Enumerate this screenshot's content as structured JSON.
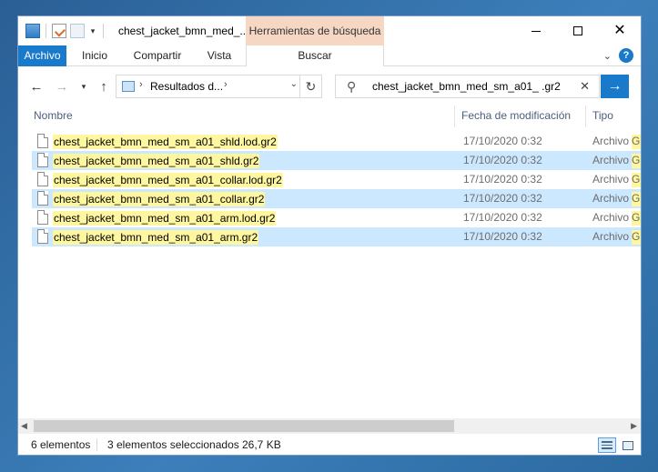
{
  "window": {
    "title": "chest_jacket_bmn_med_...",
    "contextual_header": "Herramientas de búsqueda"
  },
  "ribbon": {
    "tabs": [
      "Archivo",
      "Inicio",
      "Compartir",
      "Vista",
      "Buscar"
    ],
    "help": "?"
  },
  "navigation": {
    "back_icon": "←",
    "forward_icon": "→",
    "recent_icon": "▾",
    "up_icon": "↑",
    "address_text": "Resultados d...",
    "breadcrumb_separator": "›",
    "address_dropdown": "⌄",
    "refresh_icon": "↻",
    "search_value": "chest_jacket_bmn_med_sm_a01_ .gr2",
    "search_clear": "✕",
    "search_go": "→"
  },
  "columns": {
    "name": "Nombre",
    "date": "Fecha de modificación",
    "type": "Tipo"
  },
  "files": [
    {
      "name": "chest_jacket_bmn_med_sm_a01_shld.lod.gr2",
      "date": "17/10/2020 0:32",
      "type": "Archivo",
      "type_cut": "G",
      "selected": false
    },
    {
      "name": "chest_jacket_bmn_med_sm_a01_shld.gr2",
      "date": "17/10/2020 0:32",
      "type": "Archivo",
      "type_cut": "G",
      "selected": true
    },
    {
      "name": "chest_jacket_bmn_med_sm_a01_collar.lod.gr2",
      "date": "17/10/2020 0:32",
      "type": "Archivo",
      "type_cut": "G",
      "selected": false
    },
    {
      "name": "chest_jacket_bmn_med_sm_a01_collar.gr2",
      "date": "17/10/2020 0:32",
      "type": "Archivo",
      "type_cut": "G",
      "selected": true
    },
    {
      "name": "chest_jacket_bmn_med_sm_a01_arm.lod.gr2",
      "date": "17/10/2020 0:32",
      "type": "Archivo",
      "type_cut": "G",
      "selected": false
    },
    {
      "name": "chest_jacket_bmn_med_sm_a01_arm.gr2",
      "date": "17/10/2020 0:32",
      "type": "Archivo",
      "type_cut": "G",
      "selected": true
    }
  ],
  "status": {
    "count": "6 elementos",
    "selected": "3 elementos seleccionados",
    "size": "26,7 KB"
  },
  "colors": {
    "accent": "#1979ca",
    "selection": "#cce8ff",
    "highlight": "#fff6a0",
    "contextual_tab": "#f6d7c3"
  }
}
